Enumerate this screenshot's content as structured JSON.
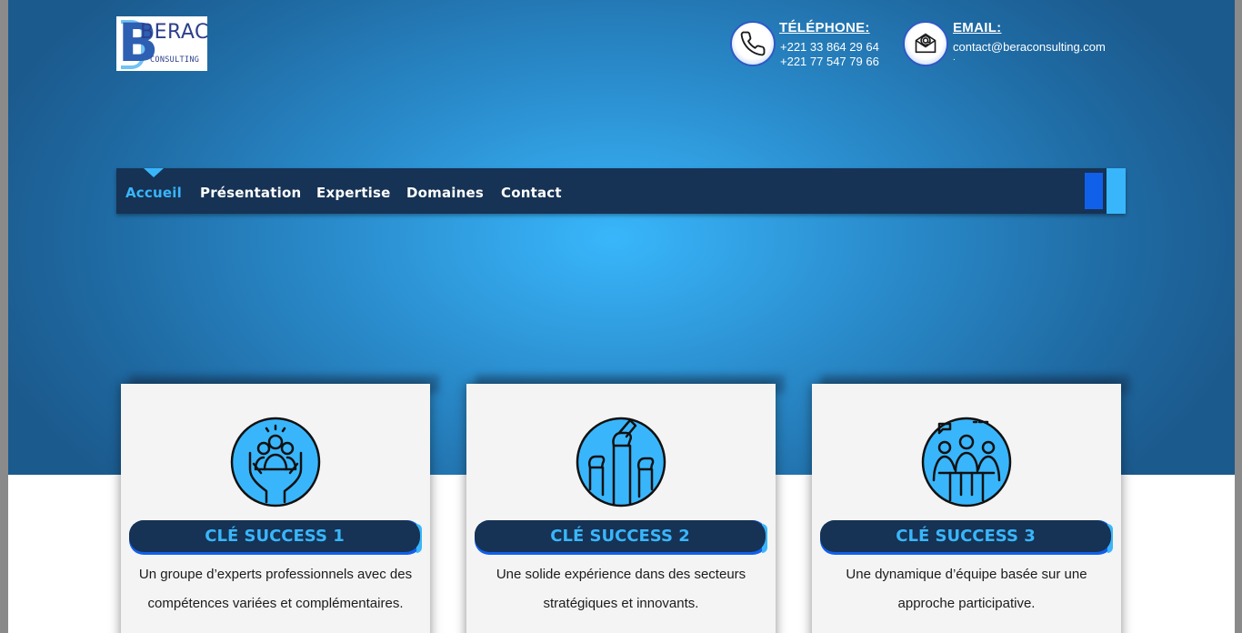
{
  "logo": {
    "name": "BERAC",
    "sub": "CONSULTING"
  },
  "contact": {
    "phone_label": "TÉLÉPHONE:",
    "phone_1": "+221 33 864 29 64",
    "phone_2": "+221 77 547 79 66",
    "email_label": "EMAIL:",
    "email": "contact@beraconsulting.com",
    "email_extra": "."
  },
  "nav": {
    "items": [
      {
        "label": "Accueil",
        "active": true
      },
      {
        "label": "Présentation"
      },
      {
        "label": "Expertise"
      },
      {
        "label": "Domaines"
      },
      {
        "label": "Contact"
      }
    ]
  },
  "cards": [
    {
      "title": "CLÉ SUCCESS 1",
      "text_1": "Un groupe d’experts professionnels avec des",
      "text_2": "compétences variées et complémentaires.",
      "icon": "hands-group-icon"
    },
    {
      "title": "CLÉ SUCCESS 2",
      "text_1": "Une solide expérience dans des secteurs",
      "text_2": "stratégiques et innovants.",
      "icon": "raised-fists-icon"
    },
    {
      "title": "CLÉ SUCCESS 3",
      "text_1": "Une dynamique d’équipe basée sur une",
      "text_2": "approche participative.",
      "icon": "team-meeting-icon"
    }
  ],
  "colors": {
    "navy": "#163254",
    "accent": "#39b6fb",
    "blue": "#1160ea"
  }
}
